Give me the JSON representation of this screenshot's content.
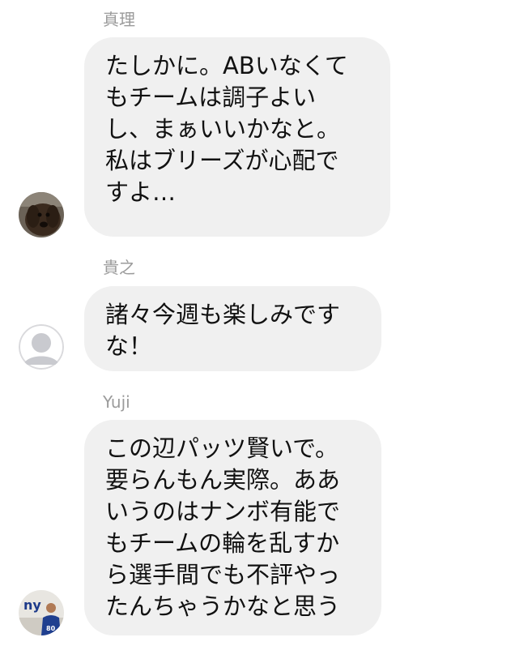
{
  "messages": [
    {
      "sender": "真理",
      "avatar_icon": "dog-photo-avatar",
      "lines": [
        "たしかに。ABいなくて",
        "もチームは調子よい",
        "し、まぁいいかなと。",
        "私はブリーズが心配で",
        "すよ…"
      ]
    },
    {
      "sender": "貴之",
      "avatar_icon": "default-person-avatar",
      "lines": [
        "諸々今週も楽しみです",
        "な！"
      ]
    },
    {
      "sender": "Yuji",
      "avatar_icon": "ny-giants-photo-avatar",
      "lines": [
        "この辺パッツ賢いで。",
        "要らんもん実際。ああ",
        "いうのはナンボ有能で",
        "もチームの輪を乱すか",
        "ら選手間でも不評やっ",
        "たんちゃうかなと思う"
      ]
    }
  ],
  "colors": {
    "bubble_bg": "#f0f0f0",
    "sender_name": "#9b9b9b",
    "text": "#111111"
  }
}
